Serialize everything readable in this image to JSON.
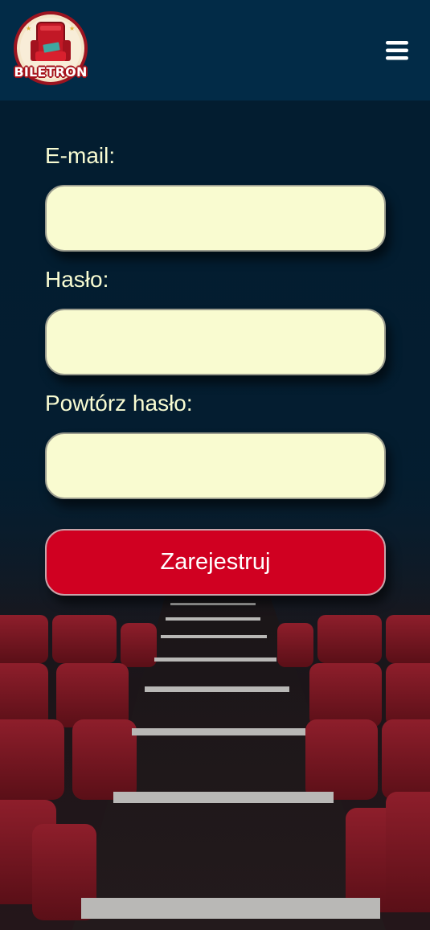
{
  "header": {
    "logo_text": "BILETRON",
    "logo_icon": "cinema-seat-ticket-icon",
    "menu_icon": "hamburger-menu-icon"
  },
  "form": {
    "email_label": "E-mail:",
    "email_value": "",
    "password_label": "Hasło:",
    "password_value": "",
    "repeat_password_label": "Powtórz hasło:",
    "repeat_password_value": "",
    "submit_label": "Zarejestruj"
  },
  "colors": {
    "header_bg": "#022b47",
    "label_text": "#f9fcd2",
    "input_bg": "#f9fbd0",
    "button_bg": "#d00021",
    "button_text": "#ffffff"
  }
}
